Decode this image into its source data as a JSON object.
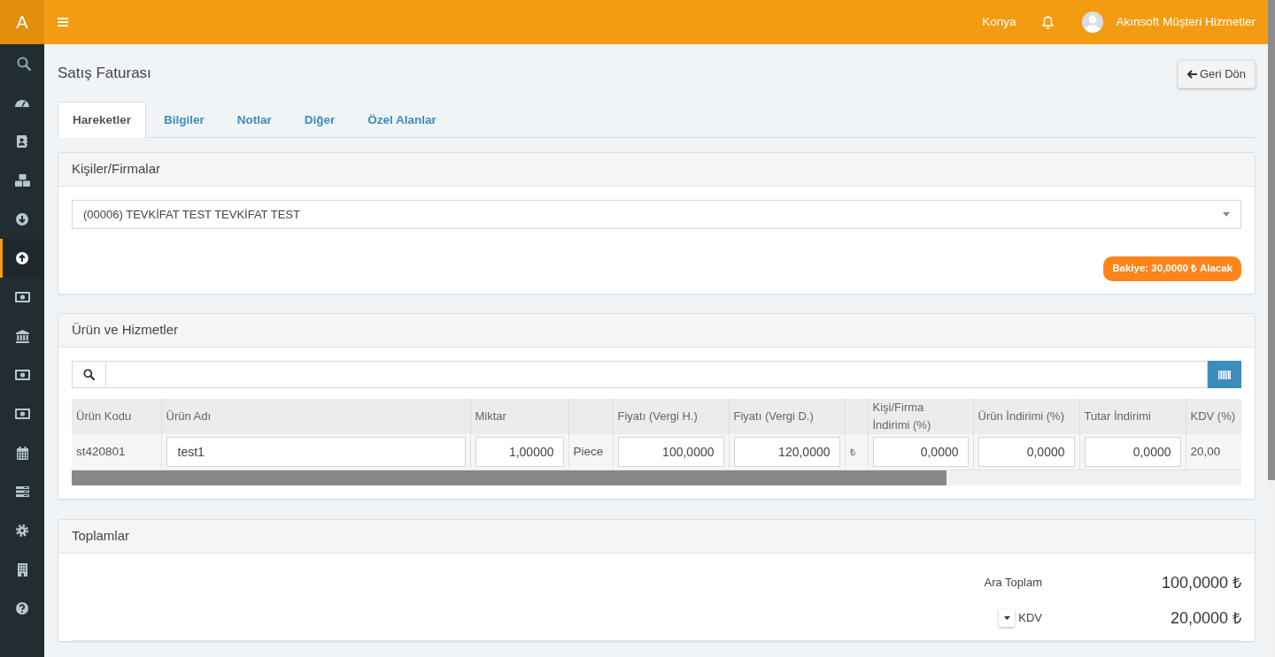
{
  "sidebar": {
    "logo": "A",
    "items": [
      {
        "selected": false
      },
      {
        "selected": false
      },
      {
        "selected": false
      },
      {
        "selected": false
      },
      {
        "selected": false
      },
      {
        "selected": true
      },
      {
        "selected": false
      },
      {
        "selected": false
      },
      {
        "selected": false
      },
      {
        "selected": false
      },
      {
        "selected": false
      },
      {
        "selected": false
      },
      {
        "selected": false
      },
      {
        "selected": false
      },
      {
        "selected": false
      }
    ]
  },
  "topbar": {
    "location": "Konya",
    "user_name": "Akınsoft Müşteri Hizmetler"
  },
  "page": {
    "title": "Satış Faturası",
    "back_button": "Geri Dön"
  },
  "tabs": [
    {
      "label": "Hareketler",
      "selected": true
    },
    {
      "label": "Bilgiler",
      "selected": false
    },
    {
      "label": "Notlar",
      "selected": false
    },
    {
      "label": "Diğer",
      "selected": false
    },
    {
      "label": "Özel Alanlar",
      "selected": false
    }
  ],
  "contacts": {
    "title": "Kişiler/Firmalar",
    "selected_contact": "(00006) TEVKİFAT TEST TEVKİFAT TEST",
    "balance": "Bakiye: 30,0000 ₺ Alacak"
  },
  "products": {
    "title": "Ürün ve Hizmetler",
    "table": {
      "columns": [
        {
          "label": "Ürün Kodu"
        },
        {
          "label": "Ürün Adı"
        },
        {
          "label": "Miktar"
        },
        {},
        {
          "label": "Fiyatı (Vergi H.)"
        },
        {
          "label": "Fiyatı (Vergi D.)"
        },
        {},
        {
          "label": "Kişi/Firma İndirimi (%)"
        },
        {
          "label": "Ürün İndirimi (%)"
        },
        {
          "label": "Tutar İndirimi"
        },
        {
          "label": "KDV (%)"
        }
      ],
      "rows": [
        {
          "cells": [
            {
              "kind": "text",
              "value": "st420801"
            },
            {
              "kind": "input",
              "value": "test1"
            },
            {
              "kind": "number",
              "value": "1,00000"
            },
            {
              "kind": "text",
              "value": "Piece"
            },
            {
              "kind": "number",
              "value": "100,0000"
            },
            {
              "kind": "number",
              "value": "120,0000"
            },
            {
              "kind": "symbol",
              "value": "₺"
            },
            {
              "kind": "number",
              "value": "0,0000"
            },
            {
              "kind": "number",
              "value": "0,0000"
            },
            {
              "kind": "number",
              "value": "0,0000"
            },
            {
              "kind": "text",
              "value": "20,00"
            }
          ]
        }
      ]
    }
  },
  "totals": {
    "title": "Toplamlar",
    "rows": [
      {
        "label": "Ara Toplam",
        "value": "100,0000 ₺",
        "dropdown": false
      },
      {
        "label": "KDV",
        "value": "20,0000 ₺",
        "dropdown": true
      }
    ]
  }
}
